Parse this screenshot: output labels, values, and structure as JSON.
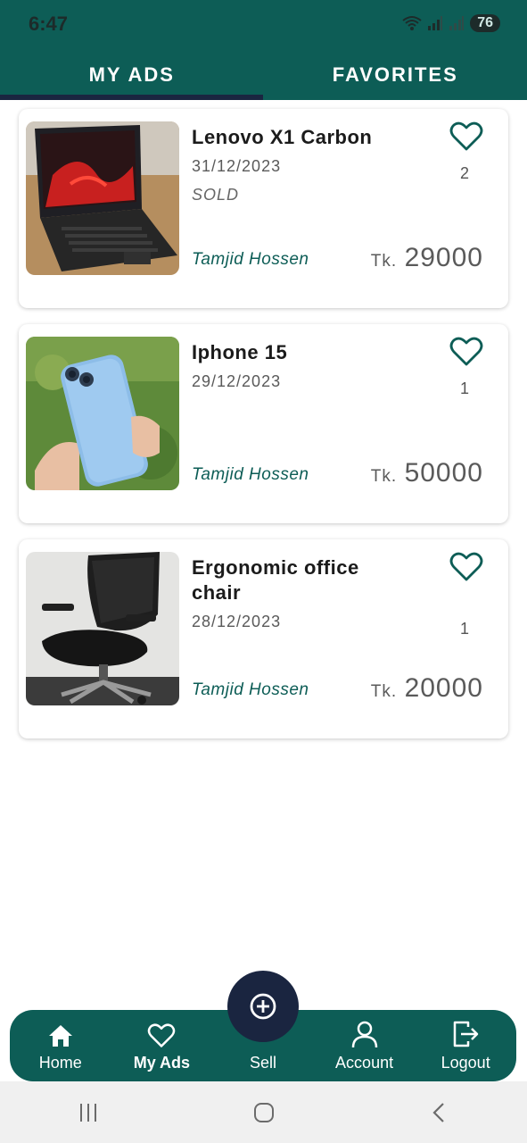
{
  "status": {
    "time": "6:47",
    "battery": "76",
    "icons": [
      "wifi-icon",
      "signal-icon",
      "signal-icon",
      "battery-icon"
    ]
  },
  "tabs": [
    {
      "label": "MY ADS",
      "active": true
    },
    {
      "label": "FAVORITES",
      "active": false
    }
  ],
  "ads": [
    {
      "title": "Lenovo X1 Carbon",
      "date": "31/12/2023",
      "status": "SOLD",
      "seller": "Tamjid Hossen",
      "currency": "Tk.",
      "price": "29000",
      "favorites": "2",
      "image": "laptop-photo"
    },
    {
      "title": "Iphone 15",
      "date": "29/12/2023",
      "status": "",
      "seller": "Tamjid Hossen",
      "currency": "Tk.",
      "price": "50000",
      "favorites": "1",
      "image": "phone-photo"
    },
    {
      "title": "Ergonomic office chair",
      "date": "28/12/2023",
      "status": "",
      "seller": "Tamjid Hossen",
      "currency": "Tk.",
      "price": "20000",
      "favorites": "1",
      "image": "chair-photo"
    }
  ],
  "nav": {
    "items": [
      {
        "label": "Home",
        "icon": "home-icon"
      },
      {
        "label": "My Ads",
        "icon": "heart-icon",
        "active": true
      },
      {
        "label": "Sell",
        "icon": "plus-circle-icon"
      },
      {
        "label": "Account",
        "icon": "user-icon"
      },
      {
        "label": "Logout",
        "icon": "logout-icon"
      }
    ]
  },
  "colors": {
    "primary": "#0d5d56",
    "dark": "#1a2540"
  }
}
